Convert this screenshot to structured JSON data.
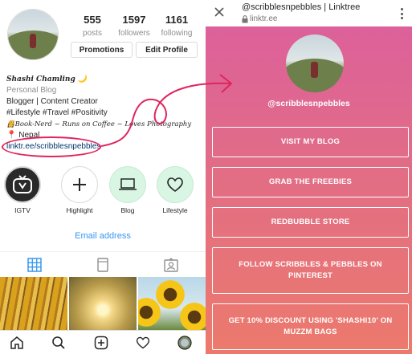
{
  "instagram": {
    "stats": [
      {
        "num": "555",
        "label": "posts"
      },
      {
        "num": "1597",
        "label": "followers"
      },
      {
        "num": "1161",
        "label": "following"
      }
    ],
    "buttons": {
      "promotions": "Promotions",
      "edit_profile": "Edit Profile"
    },
    "bio": {
      "name": "Shashi Chamling 🌙",
      "category": "Personal Blog",
      "line1": "Blogger | Content Creator",
      "line2": "#Lifestyle #Travel #Positivity",
      "line3": "👸Book-Nerd ~ Runs on Coffee ~ Loves Photography",
      "location": "📍 Nepal",
      "link": "linktr.ee/scribblesnpebbles"
    },
    "highlights": [
      "IGTV",
      "Highlight",
      "Blog",
      "Lifestyle"
    ],
    "email_label": "Email address",
    "icons": {
      "tabs": [
        "grid-icon",
        "igtv-tab-icon",
        "tagged-icon"
      ],
      "nav": [
        "home-icon",
        "search-icon",
        "new-post-icon",
        "activity-icon",
        "profile-icon"
      ]
    }
  },
  "linktree": {
    "title": "@scribblesnpebbles | Linktree",
    "url": "linktr.ee",
    "handle": "@scribblesnpebbles",
    "links": [
      "VISIT MY BLOG",
      "GRAB THE FREEBIES",
      "REDBUBBLE STORE",
      "FOLLOW SCRIBBLES & PEBBLES ON PINTEREST",
      "GET 10% DISCOUNT USING 'SHASHI10' ON MUZZM BAGS"
    ]
  },
  "colors": {
    "link_blue": "#3897f0",
    "annotation_red": "#e0245e",
    "linktree_gradient_top": "#dc5e9e",
    "linktree_gradient_bottom": "#ec7a6c"
  }
}
